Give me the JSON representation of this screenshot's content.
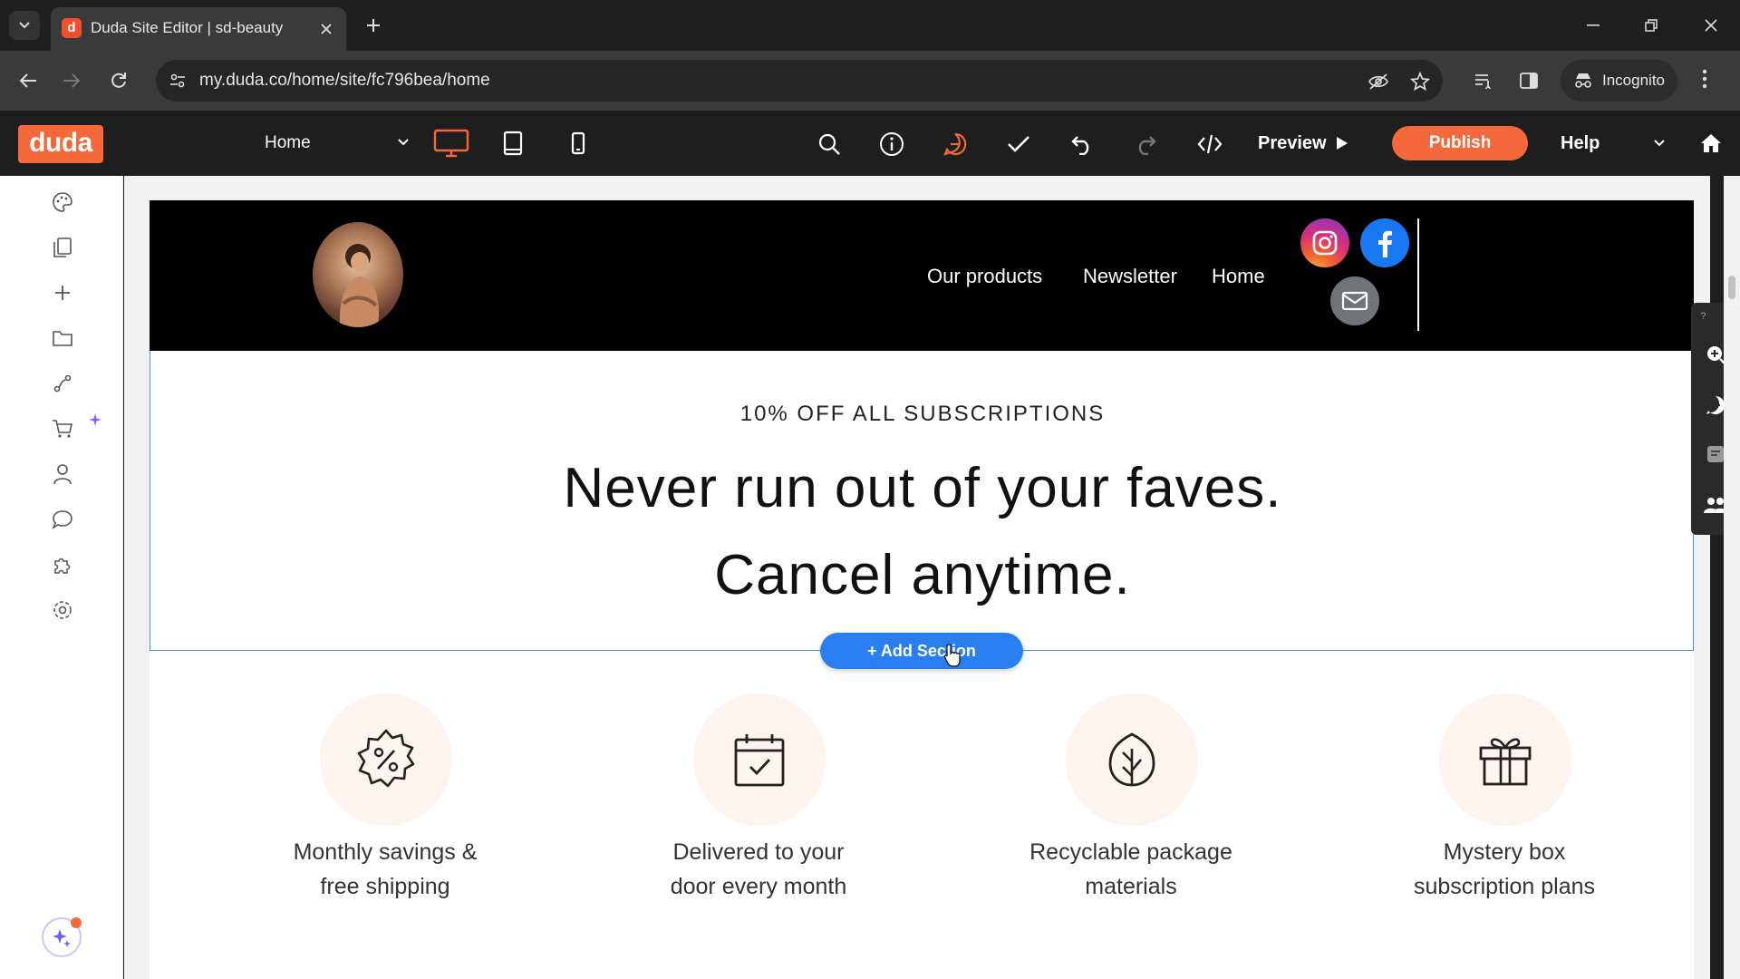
{
  "browser": {
    "tab_title": "Duda Site Editor | sd-beauty",
    "favicon_letter": "d",
    "url": "my.duda.co/home/site/fc796bea/home",
    "incognito_label": "Incognito"
  },
  "editor": {
    "logo": "duda",
    "page_select": "Home",
    "preview_label": "Preview",
    "publish_label": "Publish",
    "help_label": "Help",
    "accent_color": "#f4683c",
    "device_views": [
      "desktop-icon",
      "tablet-icon",
      "mobile-icon"
    ],
    "tools": [
      "search-icon",
      "info-icon",
      "chat-icon",
      "check-icon",
      "undo-icon",
      "redo-icon",
      "code-icon"
    ]
  },
  "sidebar": {
    "items": [
      "palette-icon",
      "pages-icon",
      "plus-icon",
      "folder-icon",
      "flow-icon",
      "cart-icon",
      "user-icon",
      "comment-icon",
      "puzzle-icon",
      "settings-icon"
    ]
  },
  "site": {
    "nav": [
      "Our products",
      "Newsletter",
      "Home"
    ],
    "hero": {
      "eyebrow": "10% OFF ALL SUBSCRIPTIONS",
      "title_line1": "Never run out of your faves.",
      "title_line2": "Cancel anytime."
    },
    "add_section_label": "+ Add Section",
    "features": [
      {
        "icon": "percent-badge-icon",
        "line1": "Monthly savings &",
        "line2": "free shipping"
      },
      {
        "icon": "calendar-check-icon",
        "line1": "Delivered to your",
        "line2": "door every month"
      },
      {
        "icon": "leaf-icon",
        "line1": "Recyclable package",
        "line2": "materials"
      },
      {
        "icon": "gift-icon",
        "line1": "Mystery box",
        "line2": "subscription plans"
      }
    ]
  }
}
